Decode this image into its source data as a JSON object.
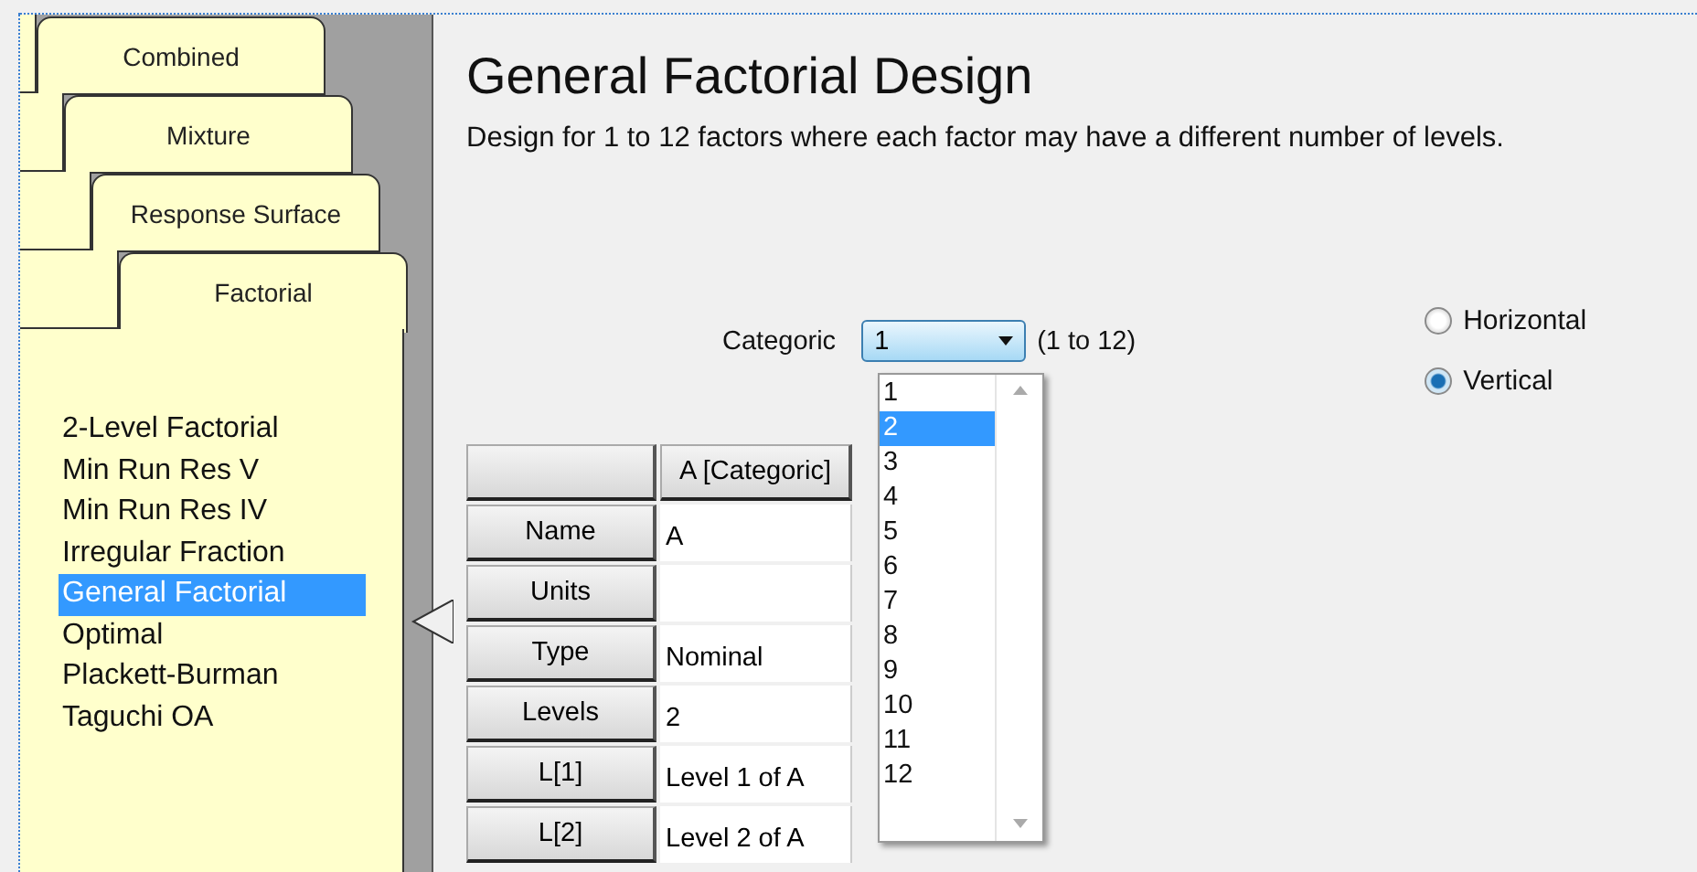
{
  "tabs": [
    {
      "label": "Combined",
      "selected": false
    },
    {
      "label": "Mixture",
      "selected": false
    },
    {
      "label": "Response Surface",
      "selected": false
    },
    {
      "label": "Factorial",
      "selected": true
    }
  ],
  "design_list": [
    {
      "label": "2-Level Factorial",
      "selected": false
    },
    {
      "label": "Min Run Res V",
      "selected": false
    },
    {
      "label": "Min Run Res IV",
      "selected": false
    },
    {
      "label": "Irregular Fraction",
      "selected": false
    },
    {
      "label": "General Factorial",
      "selected": true
    },
    {
      "label": "Optimal",
      "selected": false
    },
    {
      "label": "Plackett-Burman",
      "selected": false
    },
    {
      "label": "Taguchi OA",
      "selected": false
    }
  ],
  "title": "General Factorial Design",
  "description": "Design for 1 to 12 factors where each factor may have a different number of levels.",
  "factor_count": {
    "label": "Categoric",
    "value": "1",
    "range": "(1 to 12)",
    "options": [
      {
        "label": "1",
        "highlighted": false
      },
      {
        "label": "2",
        "highlighted": true
      },
      {
        "label": "3",
        "highlighted": false
      },
      {
        "label": "4",
        "highlighted": false
      },
      {
        "label": "5",
        "highlighted": false
      },
      {
        "label": "6",
        "highlighted": false
      },
      {
        "label": "7",
        "highlighted": false
      },
      {
        "label": "8",
        "highlighted": false
      },
      {
        "label": "9",
        "highlighted": false
      },
      {
        "label": "10",
        "highlighted": false
      },
      {
        "label": "11",
        "highlighted": false
      },
      {
        "label": "12",
        "highlighted": false
      }
    ]
  },
  "orientation": [
    {
      "label": "Horizontal",
      "selected": false
    },
    {
      "label": "Vertical",
      "selected": true
    }
  ],
  "factor_table": {
    "columns": [
      "A [Categoric]"
    ],
    "rows": [
      {
        "header": "Name",
        "value": "A"
      },
      {
        "header": "Units"
      },
      {
        "header": "Type",
        "value": "Nominal"
      },
      {
        "header": "Levels",
        "value": "2"
      },
      {
        "header": "L[1]",
        "value": "Level 1 of A"
      },
      {
        "header": "L[2]",
        "value": "Level 2 of A"
      }
    ]
  }
}
